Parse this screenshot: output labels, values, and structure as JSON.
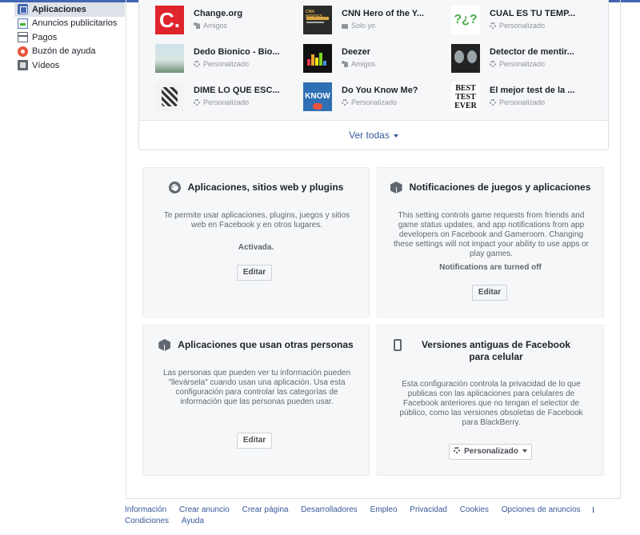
{
  "sidebar": {
    "items": [
      {
        "label": "Aplicaciones",
        "icon": "apps-icon",
        "active": true
      },
      {
        "label": "Anuncios publicitarios",
        "icon": "ads-icon"
      },
      {
        "label": "Pagos",
        "icon": "payments-icon"
      },
      {
        "label": "Buzón de ayuda",
        "icon": "help-inbox-icon"
      },
      {
        "label": "Vídeos",
        "icon": "videos-icon"
      }
    ]
  },
  "apps": {
    "items": [
      {
        "name": "Change.org",
        "visibility": "Amigos",
        "thumb_text": "C."
      },
      {
        "name": "CNN Hero of the Y...",
        "visibility": "Solo yo",
        "thumb_text": "CNN HEROES"
      },
      {
        "name": "CUAL ES TU TEMP...",
        "visibility": "Personalizado",
        "thumb_text": "?¿?"
      },
      {
        "name": "Dedo Bionico - Bio...",
        "visibility": "Personalizado"
      },
      {
        "name": "Deezer",
        "visibility": "Amigos"
      },
      {
        "name": "Detector de mentir...",
        "visibility": "Personalizado"
      },
      {
        "name": "DIME LO QUE ESC...",
        "visibility": "Personalizado"
      },
      {
        "name": "Do You Know Me?",
        "visibility": "Personalizado",
        "thumb_text": "KNOW ME?"
      },
      {
        "name": "El mejor test de la ...",
        "visibility": "Personalizado",
        "thumb_lines": [
          "BEST",
          "TEST",
          "EVER"
        ]
      }
    ],
    "see_all": "Ver todas"
  },
  "cards": {
    "apps_websites": {
      "title": "Aplicaciones, sitios web y plugins",
      "description": "Te permite usar aplicaciones, plugins, juegos y sitios web en Facebook y en otros lugares.",
      "status": "Activada.",
      "button": "Editar"
    },
    "game_notifications": {
      "title": "Notificaciones de juegos y aplicaciones",
      "description": "This setting controls game requests from friends and game status updates, and app notifications from app developers on Facebook and Gameroom. Changing these settings will not impact your ability to use apps or play games.",
      "status": "Notifications are turned off",
      "button": "Editar"
    },
    "apps_others_use": {
      "title": "Aplicaciones que usan otras personas",
      "description": "Las personas que pueden ver tu información pueden \"llevársela\" cuando usan una aplicación. Usa esta configuración para controlar las categorías de información que las personas pueden usar.",
      "button": "Editar"
    },
    "old_mobile": {
      "title": "Versiones antiguas de Facebook para celular",
      "description": "Esta configuración controla la privacidad de lo que publicas con las aplicaciones para celulares de Facebook anteriores que no tengan el selector de público, como las versiones obsoletas de Facebook para BlackBerry.",
      "button": "Personalizado"
    }
  },
  "footer": {
    "links": [
      "Información",
      "Crear anuncio",
      "Crear página",
      "Desarrolladores",
      "Empleo",
      "Privacidad",
      "Cookies",
      "Opciones de anuncios",
      "Condiciones",
      "Ayuda"
    ]
  },
  "colors": {
    "link": "#365899",
    "brand": "#4267b2",
    "card_bg": "#f6f7f9"
  }
}
